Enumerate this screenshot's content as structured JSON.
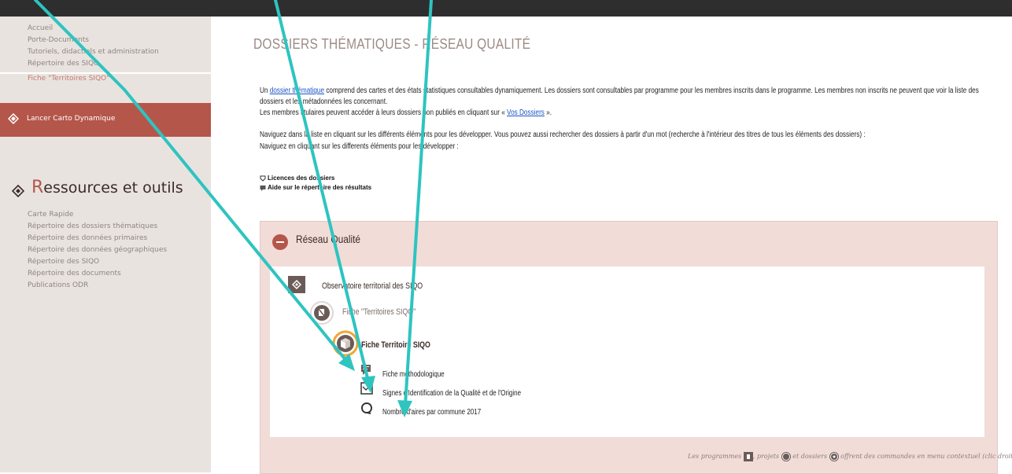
{
  "colors": {
    "accent": "#b5564b",
    "sidebar_bg": "#e9e3e0",
    "panel_bg": "#f1dcd8",
    "arrow": "#2ec4c0",
    "topbar": "#2e2e2e"
  },
  "sidebar": {
    "nav": [
      "Accueil",
      "Porte-Documents",
      "Tutoriels, didactiels et administration",
      "Répertoire des SIQO",
      "Fiche \"Territoires SIQO\""
    ],
    "launch_label": "Lancer Carto Dynamique",
    "resources_title_first": "R",
    "resources_title_rest": "essources et outils",
    "resources": [
      "Carte Rapide",
      "Répertoire des dossiers thématiques",
      "Répertoire des données primaires",
      "Répertoire des données géographiques",
      "Répertoire des SIQO",
      "Répertoire des documents",
      "Publications ODR"
    ]
  },
  "main": {
    "title": "DOSSIERS THÉMATIQUES - RÉSEAU QUALITÉ",
    "intro_part1": "Un ",
    "intro_link": "dossier thématique",
    "intro_part2": " comprend des cartes et des états statistiques consultables dynamiquement. Les dossiers sont consultables par programme pour les membres inscrits dans le programme. Les membres non inscrits ne peuvent que voir la liste des",
    "intro_line2": "dossiers et les métadonnées les concernant.",
    "intro_line3_part1": "Les membres titulaires peuvent accéder à leurs dossiers non publiés en cliquant sur « ",
    "intro_line3_link": "Vos Dossiers",
    "intro_line3_part2": " ».",
    "nav_line1": "Naviguez dans la liste en cliquant sur les différents éléments pour les développer. Vous pouvez aussi rechercher des dossiers à partir d'un mot (recherche à l'intérieur des titres de tous les éléments des dossiers) :",
    "nav_line2": "Naviguez en cliquant sur les differents éléments pour les développer :",
    "licences_link": "Licences des dossiers",
    "help_link": "Aide sur le répertoire des résultats"
  },
  "tree": {
    "panel_title": "Réseau Qualité",
    "program": "Observatoire territorial des SIQO",
    "project": "Fiche \"Territoires SIQO\"",
    "dossier": "Fiche Territoire SIQO",
    "items": [
      "Fiche méthodologique",
      "Signes d'Identification de la Qualité et de l'Origine",
      "Nombre d'aires par commune 2017"
    ],
    "footnote_a": "Les programmes",
    "footnote_b": ", projets",
    "footnote_c": " et dossiers",
    "footnote_d": " offrent des commandes en menu contextuel (clic droit)"
  }
}
